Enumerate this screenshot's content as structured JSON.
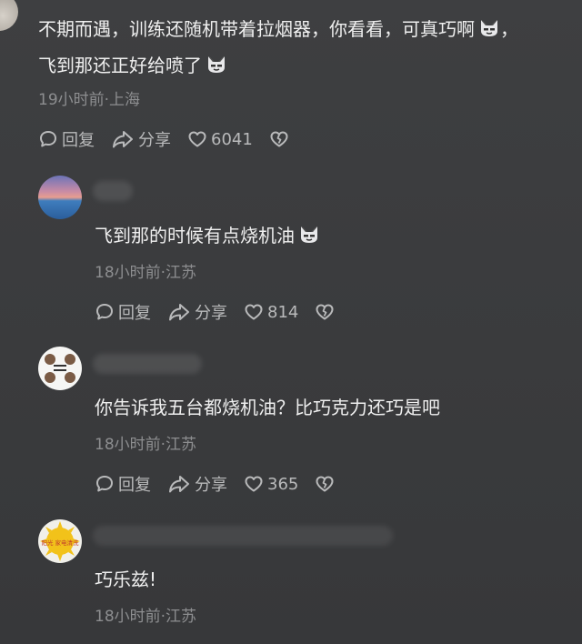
{
  "top_comment": {
    "line1": "不期而遇，训练还随机带着拉烟器，你看看，可真巧啊",
    "line1_tail": "，",
    "line2": "飞到那还正好给喷了",
    "meta": "19小时前·上海",
    "reply_label": "回复",
    "share_label": "分享",
    "likes": "6041"
  },
  "replies": [
    {
      "text": "飞到那的时候有点烧机油",
      "meta": "18小时前·江苏",
      "reply_label": "回复",
      "share_label": "分享",
      "likes": "814"
    },
    {
      "text": "你告诉我五台都烧机油？比巧克力还巧是吧",
      "meta": "18小时前·江苏",
      "reply_label": "回复",
      "share_label": "分享",
      "likes": "365"
    },
    {
      "text": "巧乐兹!",
      "meta": "18小时前·江苏"
    }
  ],
  "avatar3_badge": "阳光 家电清洗",
  "icons": {
    "reply": "comment-bubble-icon",
    "share": "share-arrow-icon",
    "like": "heart-icon",
    "dislike": "broken-heart-icon",
    "emoji": "cat-emoji-icon"
  }
}
